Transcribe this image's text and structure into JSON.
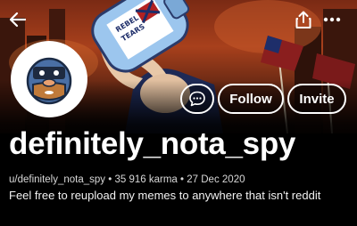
{
  "profile": {
    "display_name": "definitely_nota_spy",
    "handle": "u/definitely_nota_spy",
    "karma": "35 916 karma",
    "cake_day": "27 Dec 2020",
    "separator": "•",
    "bio": "Feel free to reupload my memes to anywhere that isn't reddit"
  },
  "actions": {
    "follow_label": "Follow",
    "invite_label": "Invite"
  },
  "banner": {
    "jug_label_line1": "REBEL",
    "jug_label_line2": "TEARS"
  },
  "icons": {
    "back": "arrow-left-icon",
    "share": "share-icon",
    "more": "more-horizontal-icon",
    "chat": "chat-bubble-icon"
  },
  "colors": {
    "background": "#000000",
    "text": "#ffffff",
    "meta_text": "#d8d8d8",
    "banner_accent": "#a8401c"
  }
}
